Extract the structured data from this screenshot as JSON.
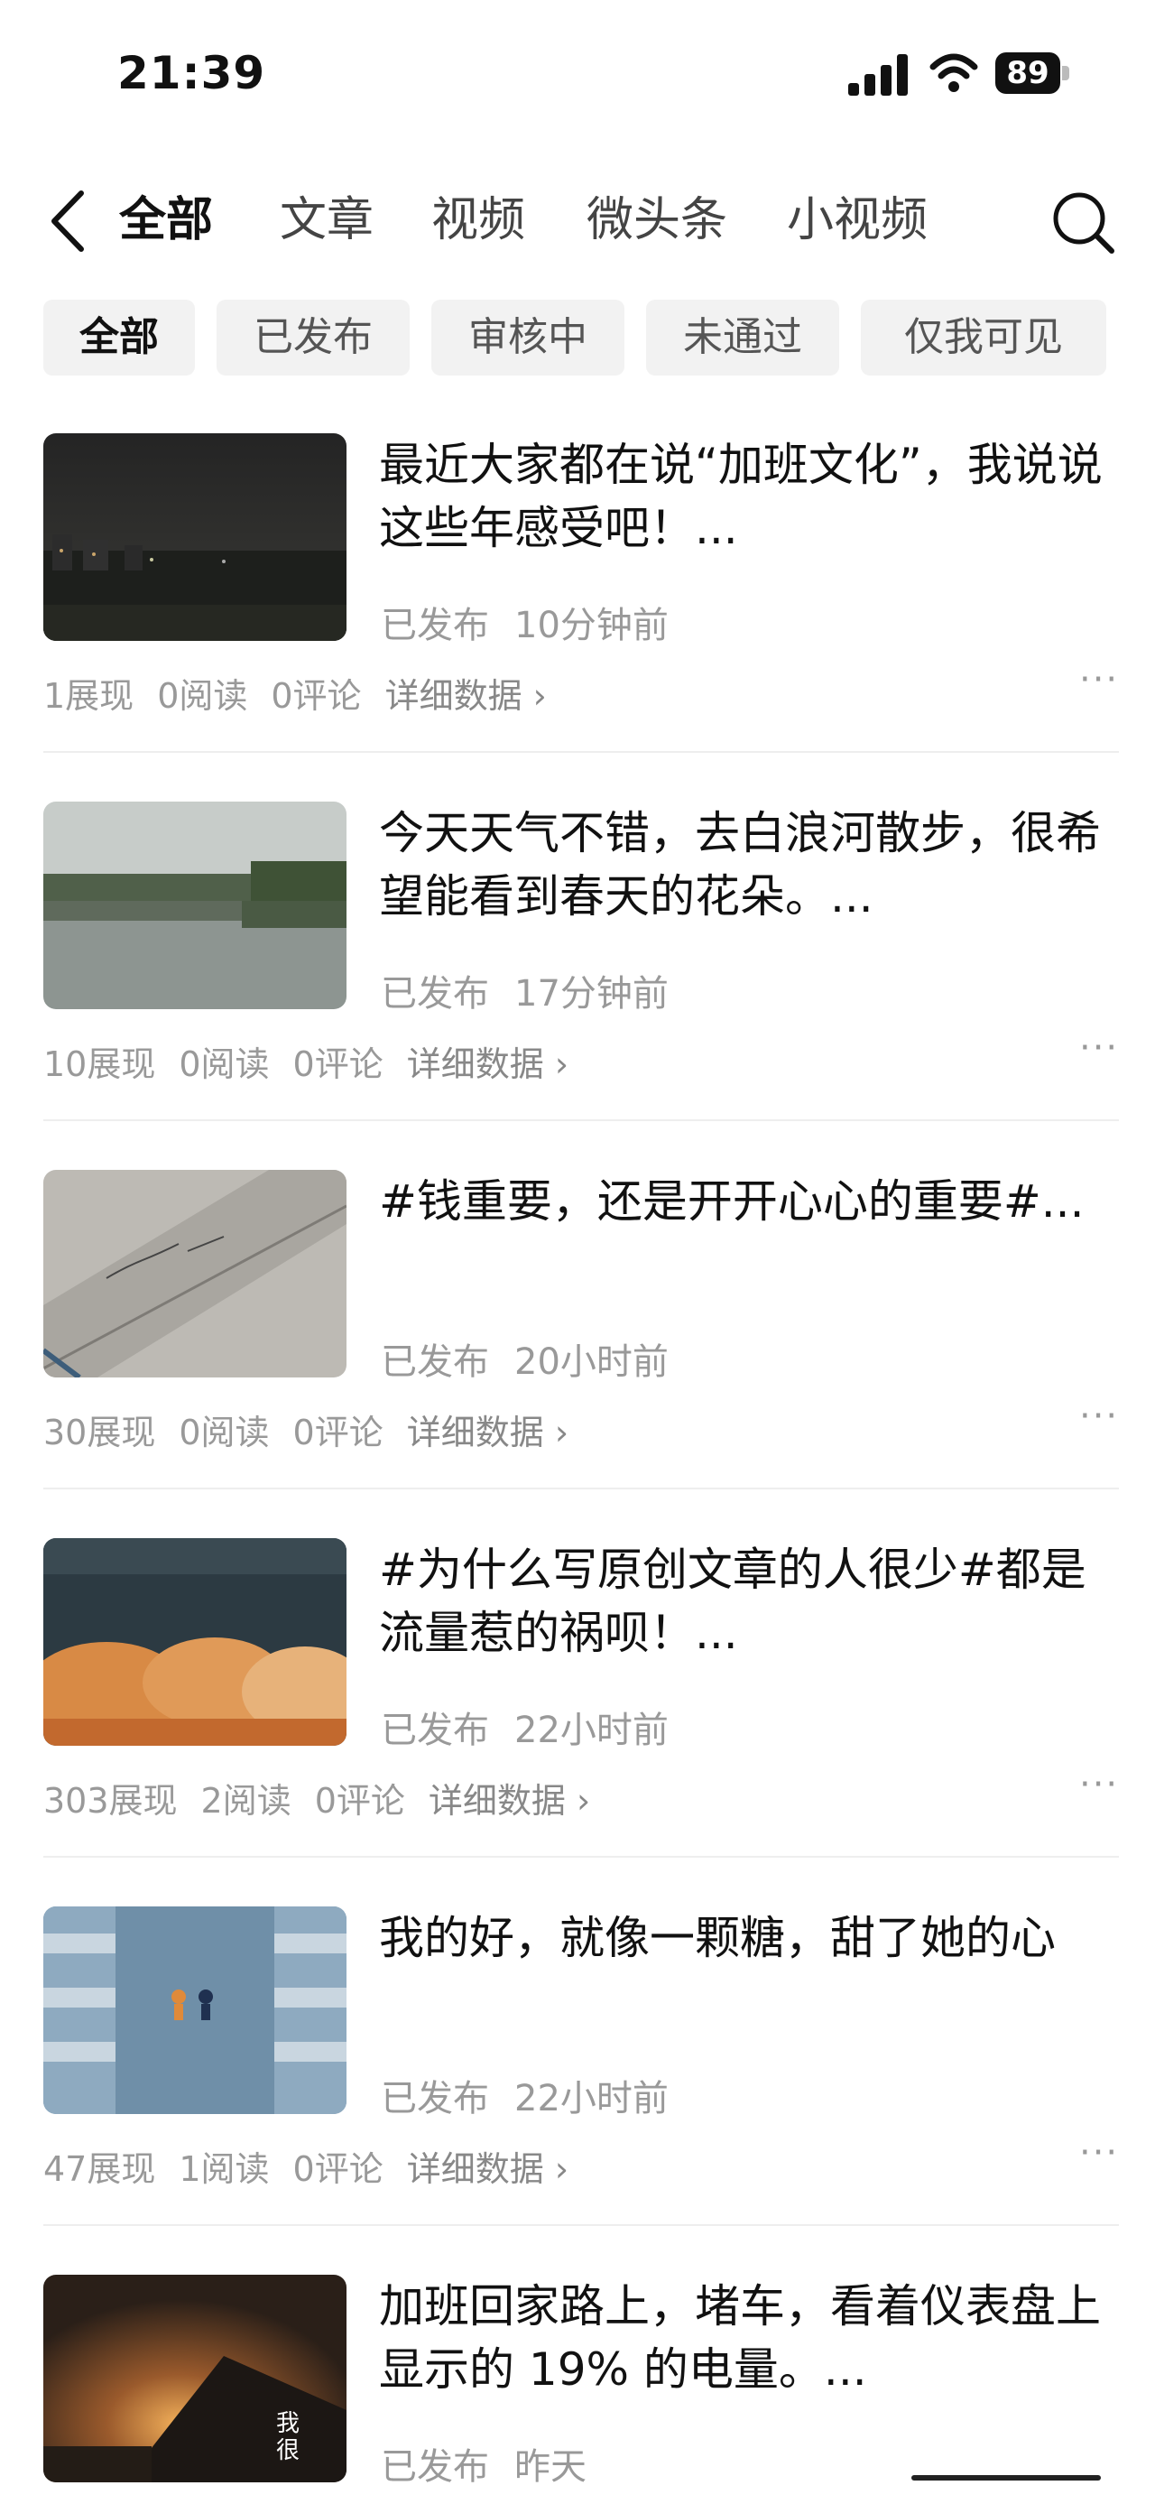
{
  "status_bar": {
    "time": "21:39",
    "battery": "89"
  },
  "nav": {
    "tabs": [
      {
        "label": "全部",
        "active": true
      },
      {
        "label": "文章",
        "active": false
      },
      {
        "label": "视频",
        "active": false
      },
      {
        "label": "微头条",
        "active": false
      },
      {
        "label": "小视频",
        "active": false
      }
    ]
  },
  "filters": [
    {
      "label": "全部",
      "active": true
    },
    {
      "label": "已发布",
      "active": false
    },
    {
      "label": "审核中",
      "active": false
    },
    {
      "label": "未通过",
      "active": false
    },
    {
      "label": "仅我可见",
      "active": false
    }
  ],
  "items": [
    {
      "title": "最近大家都在说“加班文化”，我说说这些年感受吧！...",
      "status": "已发布",
      "time": "10分钟前",
      "impressions": "1展现",
      "reads": "0阅读",
      "comments": "0评论",
      "detail": "详细数据 ›",
      "more": "···"
    },
    {
      "title": "今天天气不错，去白浪河散步，很希望能看到春天的花朵。...",
      "status": "已发布",
      "time": "17分钟前",
      "impressions": "10展现",
      "reads": "0阅读",
      "comments": "0评论",
      "detail": "详细数据 ›",
      "more": "···"
    },
    {
      "title": "#钱重要，还是开开心心的重要#...",
      "status": "已发布",
      "time": "20小时前",
      "impressions": "30展现",
      "reads": "0阅读",
      "comments": "0评论",
      "detail": "详细数据 ›",
      "more": "···"
    },
    {
      "title": "#为什么写原创文章的人很少#都是流量惹的祸呗！...",
      "status": "已发布",
      "time": "22小时前",
      "impressions": "303展现",
      "reads": "2阅读",
      "comments": "0评论",
      "detail": "详细数据 ›",
      "more": "···"
    },
    {
      "title": "我的好，就像一颗糖，甜了她的心",
      "status": "已发布",
      "time": "22小时前",
      "impressions": "47展现",
      "reads": "1阅读",
      "comments": "0评论",
      "detail": "详细数据 ›",
      "more": "···"
    },
    {
      "title": "加班回家路上，堵车，看着仪表盘上显示的 19% 的电量。...",
      "status": "已发布",
      "time": "昨天",
      "thumb_text": "我很",
      "impressions": "",
      "reads": "",
      "comments": "",
      "detail": "",
      "more": ""
    }
  ]
}
